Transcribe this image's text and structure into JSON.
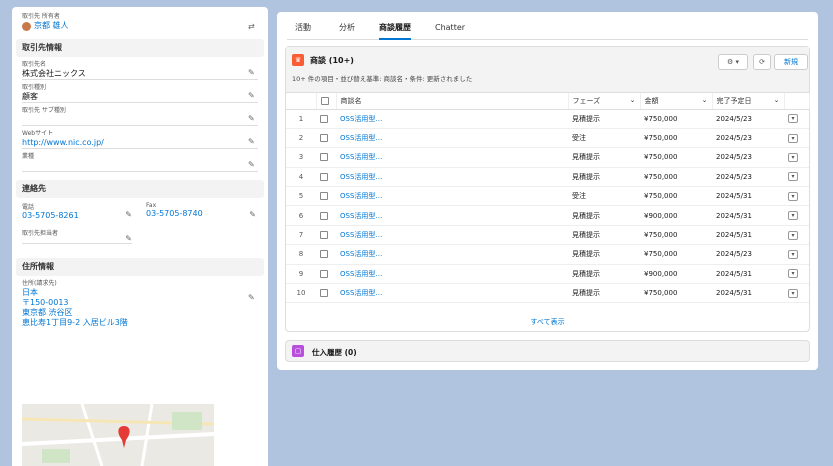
{
  "left": {
    "owner_label": "取引先 所有者",
    "owner_name": "京都 雄人",
    "sections": {
      "company": "取引先情報",
      "contact": "連絡先",
      "address": "住所情報"
    },
    "fields": [
      {
        "label": "取引先名",
        "value": "株式会社ニックス",
        "link": false
      },
      {
        "label": "取引種別",
        "value": "顧客",
        "link": false
      },
      {
        "label": "取引先 サブ種別",
        "value": "",
        "link": false
      },
      {
        "label": "Webサイト",
        "value": "http://www.nic.co.jp/",
        "link": true
      },
      {
        "label": "業種",
        "value": "",
        "link": false
      }
    ],
    "phone_label": "電話",
    "phone_value": "03-5705-8261",
    "fax_label": "Fax",
    "fax_value": "03-5705-8740",
    "contact_other_label": "取引先担当者",
    "address_label": "住所(請求先)",
    "address_lines": [
      "日本",
      "〒150-0013",
      "東京都 渋谷区",
      "恵比寿1丁目9-2 入居ビル3階"
    ]
  },
  "tabs": [
    "活動",
    "分析",
    "商談履歴",
    "Chatter"
  ],
  "active_tab": 2,
  "opportunities": {
    "title": "商談 (10+)",
    "subtitle": "10+ 件の項目・並び替え基準: 商談名・条件: 更新されました",
    "new_button": "新規",
    "view_all": "すべて表示",
    "columns": [
      "商談名",
      "フェーズ",
      "金額",
      "完了予定日"
    ],
    "rows": [
      {
        "n": "1",
        "name": "OSS活用型…",
        "phase": "見積提示",
        "amount": "¥750,000",
        "date": "2024/5/23"
      },
      {
        "n": "2",
        "name": "OSS活用型…",
        "phase": "受注",
        "amount": "¥750,000",
        "date": "2024/5/23"
      },
      {
        "n": "3",
        "name": "OSS活用型…",
        "phase": "見積提示",
        "amount": "¥750,000",
        "date": "2024/5/23"
      },
      {
        "n": "4",
        "name": "OSS活用型…",
        "phase": "見積提示",
        "amount": "¥750,000",
        "date": "2024/5/23"
      },
      {
        "n": "5",
        "name": "OSS活用型…",
        "phase": "受注",
        "amount": "¥750,000",
        "date": "2024/5/31"
      },
      {
        "n": "6",
        "name": "OSS活用型…",
        "phase": "見積提示",
        "amount": "¥900,000",
        "date": "2024/5/31"
      },
      {
        "n": "7",
        "name": "OSS活用型…",
        "phase": "見積提示",
        "amount": "¥750,000",
        "date": "2024/5/31"
      },
      {
        "n": "8",
        "name": "OSS活用型…",
        "phase": "見積提示",
        "amount": "¥750,000",
        "date": "2024/5/23"
      },
      {
        "n": "9",
        "name": "OSS活用型…",
        "phase": "見積提示",
        "amount": "¥900,000",
        "date": "2024/5/31"
      },
      {
        "n": "10",
        "name": "OSS活用型…",
        "phase": "見積提示",
        "amount": "¥750,000",
        "date": "2024/5/31"
      }
    ]
  },
  "related2": {
    "title": "仕入履歴 (0)"
  },
  "colors": {
    "accent": "#0176d3",
    "opp_icon": "#fc5c35",
    "purchase_icon": "#b850dd"
  }
}
